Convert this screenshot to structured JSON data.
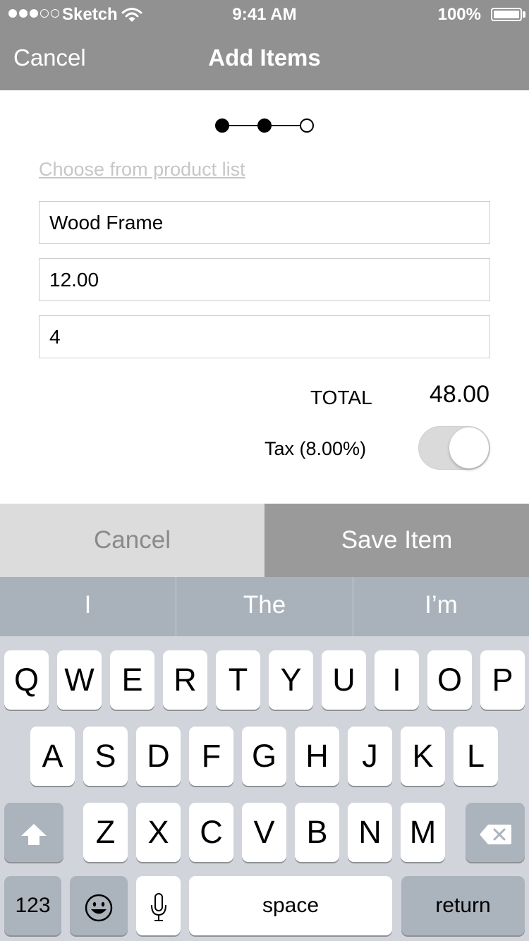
{
  "status_bar": {
    "carrier": "Sketch",
    "time": "9:41 AM",
    "battery": "100%",
    "signal_bars_filled": 3,
    "signal_bars_total": 5,
    "signal_icon": "signal-dots-icon",
    "wifi_icon": "wifi-icon",
    "battery_icon": "battery-icon"
  },
  "nav": {
    "cancel_label": "Cancel",
    "title": "Add Items"
  },
  "progress": {
    "current_step": 2,
    "total_steps": 3
  },
  "form": {
    "product_link": "Choose from product list",
    "name_value": "Wood Frame",
    "price_value": "12.00",
    "quantity_value": "4",
    "total_label": "TOTAL",
    "total_value": "48.00",
    "tax_label": "Tax (8.00%)",
    "tax_enabled": true
  },
  "actions": {
    "cancel_label": "Cancel",
    "save_label": "Save Item"
  },
  "predictive": [
    "I",
    "The",
    "I’m"
  ],
  "keyboard": {
    "row1": [
      "Q",
      "W",
      "E",
      "R",
      "T",
      "Y",
      "U",
      "I",
      "O",
      "P"
    ],
    "row2": [
      "A",
      "S",
      "D",
      "F",
      "G",
      "H",
      "J",
      "K",
      "L"
    ],
    "row3": [
      "Z",
      "X",
      "C",
      "V",
      "B",
      "N",
      "M"
    ],
    "numbers_label": "123",
    "space_label": "space",
    "return_label": "return",
    "shift_icon": "shift-icon",
    "delete_icon": "backspace-icon",
    "emoji_icon": "emoji-icon",
    "mic_icon": "microphone-icon"
  },
  "colors": {
    "nav_bg": "#919191",
    "cancel_button_bg": "#dcdcdc",
    "save_button_bg": "#9a9a9a",
    "predictive_bg": "#a9b2bb",
    "keyboard_bg": "#d1d5db",
    "function_key_bg": "#abb3bc"
  }
}
